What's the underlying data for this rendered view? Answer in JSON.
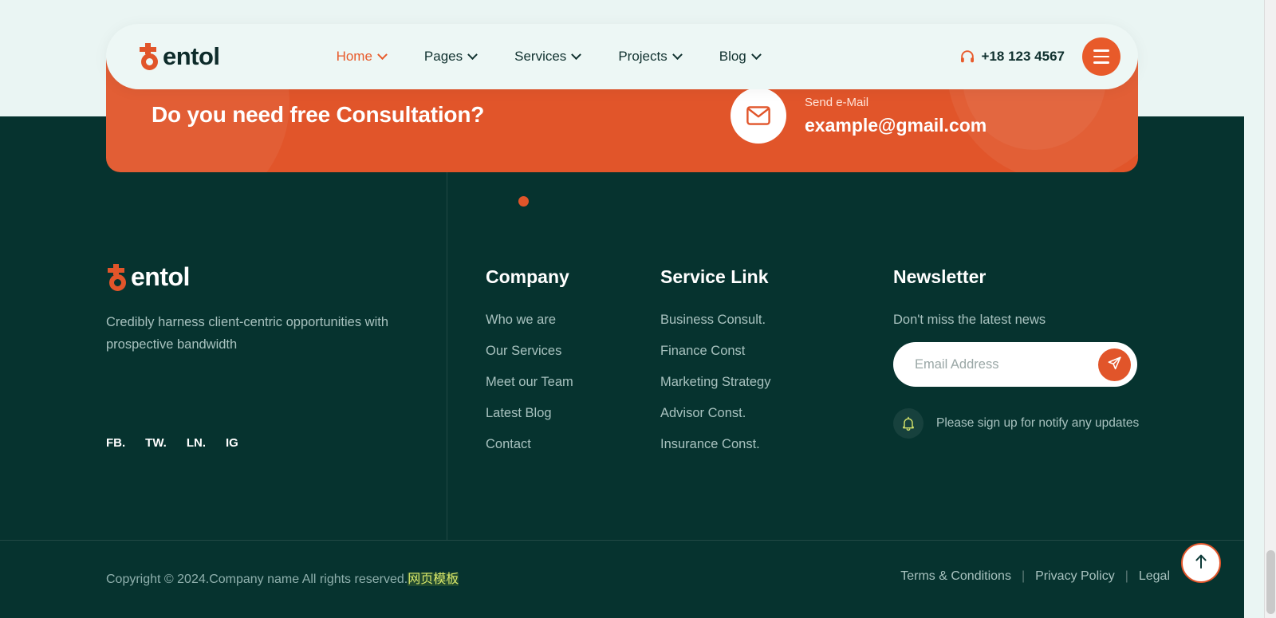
{
  "theme": {
    "accent": "#e1552a",
    "dark": "#06332f",
    "light_bg": "#eaf5f3",
    "muted_text": "#a8c2bf"
  },
  "header": {
    "brand": {
      "mark": "b-logo-icon",
      "name": "entol"
    },
    "nav": [
      {
        "label": "Home",
        "active": true,
        "icon": "chevron-down-icon"
      },
      {
        "label": "Pages",
        "active": false,
        "icon": "chevron-down-icon"
      },
      {
        "label": "Services",
        "active": false,
        "icon": "chevron-down-icon"
      },
      {
        "label": "Projects",
        "active": false,
        "icon": "chevron-down-icon"
      },
      {
        "label": "Blog",
        "active": false,
        "icon": "chevron-down-icon"
      }
    ],
    "phone": {
      "icon": "headphone-icon",
      "number": "+18 123 4567"
    },
    "menu_button": {
      "icon": "hamburger-menu-icon"
    }
  },
  "cta": {
    "title": "Do you need free Consultation?",
    "mail_icon": "envelope-icon",
    "mail_label": "Send e-Mail",
    "mail_address": "example@gmail.com"
  },
  "footer": {
    "about": {
      "brand_name": "entol",
      "tagline": "Credibly harness client-centric opportunities with prospective bandwidth",
      "social": [
        {
          "label": "FB."
        },
        {
          "label": "TW."
        },
        {
          "label": "LN."
        },
        {
          "label": "IG"
        }
      ]
    },
    "company": {
      "heading": "Company",
      "links": [
        {
          "label": "Who we are"
        },
        {
          "label": "Our Services"
        },
        {
          "label": "Meet our Team"
        },
        {
          "label": "Latest Blog"
        },
        {
          "label": "Contact"
        }
      ]
    },
    "service": {
      "heading": "Service Link",
      "links": [
        {
          "label": "Business Consult."
        },
        {
          "label": "Finance Const"
        },
        {
          "label": "Marketing Strategy"
        },
        {
          "label": "Advisor Const."
        },
        {
          "label": "Insurance Const."
        }
      ]
    },
    "newsletter": {
      "heading": "Newsletter",
      "subtitle": "Don't miss the latest news",
      "placeholder": "Email Address",
      "value": "",
      "send_icon": "paper-plane-icon",
      "note_icon": "bell-icon",
      "note": "Please sign up for notify any updates"
    }
  },
  "bottom_bar": {
    "copyright": "Copyright © 2024.Company name All rights reserved.",
    "template_link": "网页模板",
    "legal": [
      {
        "label": "Terms & Conditions"
      },
      {
        "label": "Privacy Policy"
      },
      {
        "label": "Legal"
      }
    ],
    "separator": "|"
  },
  "scroll_top": {
    "icon": "arrow-up-icon"
  }
}
